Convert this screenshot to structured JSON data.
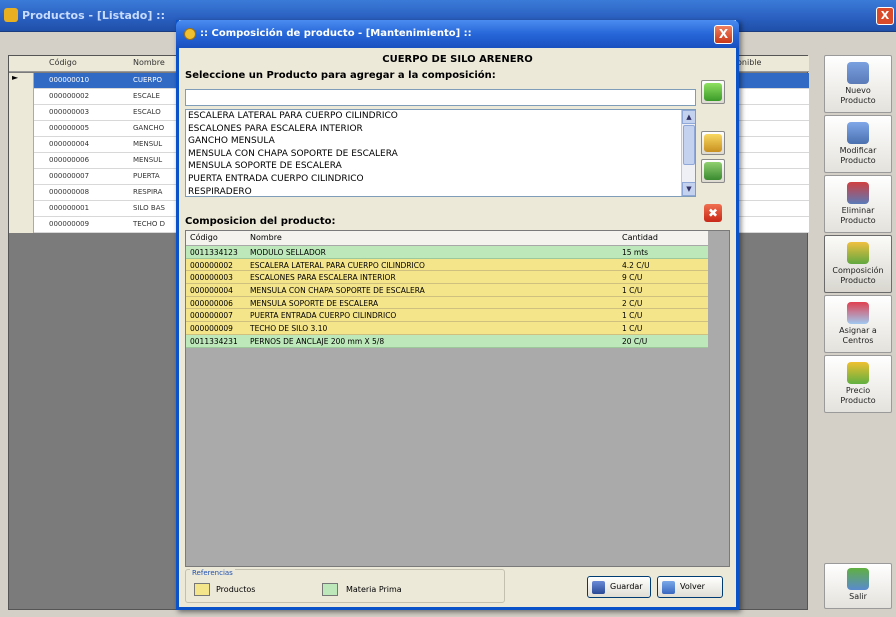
{
  "bg_window": {
    "title": "Productos - [Listado] ::",
    "close": "X"
  },
  "bg_grid": {
    "headers": [
      "Código",
      "Nombre",
      "onible"
    ],
    "rows": [
      {
        "code": "000000010",
        "name": "CUERPO"
      },
      {
        "code": "000000002",
        "name": "ESCALE"
      },
      {
        "code": "000000003",
        "name": "ESCALO"
      },
      {
        "code": "000000005",
        "name": "GANCHO"
      },
      {
        "code": "000000004",
        "name": "MENSUL"
      },
      {
        "code": "000000006",
        "name": "MENSUL"
      },
      {
        "code": "000000007",
        "name": "PUERTA"
      },
      {
        "code": "000000008",
        "name": "RESPIRA"
      },
      {
        "code": "000000001",
        "name": "SILO BAS"
      },
      {
        "code": "000000009",
        "name": "TECHO D"
      }
    ]
  },
  "right_panel": {
    "buttons": [
      {
        "label1": "Nuevo",
        "label2": "Producto"
      },
      {
        "label1": "Modificar",
        "label2": "Producto"
      },
      {
        "label1": "Eliminar",
        "label2": "Producto"
      },
      {
        "label1": "Composición",
        "label2": "Producto"
      },
      {
        "label1": "Asignar a",
        "label2": "Centros"
      },
      {
        "label1": "Precio",
        "label2": "Producto"
      }
    ],
    "exit_label": "Salir"
  },
  "dialog": {
    "title": ":: Composición de producto - [Mantenimiento] ::",
    "close": "X",
    "heading": "CUERPO DE SILO ARENERO",
    "select_label": "Seleccione un Producto para agregar a la composición:",
    "search_value": "",
    "product_list": [
      "ESCALERA LATERAL PARA CUERPO CILINDRICO",
      "ESCALONES PARA ESCALERA INTERIOR",
      "GANCHO MENSULA",
      "MENSULA CON CHAPA SOPORTE DE ESCALERA",
      "MENSULA SOPORTE DE ESCALERA",
      "PUERTA ENTRADA CUERPO CILINDRICO",
      "RESPIRADERO"
    ],
    "composition_label": "Composicion del producto:",
    "comp_headers": {
      "code": "Código",
      "name": "Nombre",
      "qty": "Cantidad"
    },
    "comp_rows": [
      {
        "code": "0011334123",
        "name": "MODULO SELLADOR",
        "qty": "15 mts",
        "kind": "g"
      },
      {
        "code": "000000002",
        "name": "ESCALERA LATERAL PARA CUERPO CILINDRICO",
        "qty": "4.2 C/U",
        "kind": "y"
      },
      {
        "code": "000000003",
        "name": "ESCALONES PARA ESCALERA INTERIOR",
        "qty": "9 C/U",
        "kind": "y"
      },
      {
        "code": "000000004",
        "name": "MENSULA CON CHAPA SOPORTE DE ESCALERA",
        "qty": "1 C/U",
        "kind": "y"
      },
      {
        "code": "000000006",
        "name": "MENSULA SOPORTE DE ESCALERA",
        "qty": "2 C/U",
        "kind": "y"
      },
      {
        "code": "000000007",
        "name": "PUERTA ENTRADA CUERPO CILINDRICO",
        "qty": "1 C/U",
        "kind": "y"
      },
      {
        "code": "000000009",
        "name": "TECHO DE SILO 3.10",
        "qty": "1 C/U",
        "kind": "y"
      },
      {
        "code": "0011334231",
        "name": "PERNOS DE ANCLAJE 200 mm X 5/8",
        "qty": "20 C/U",
        "kind": "g"
      }
    ],
    "refs_title": "Referencias",
    "ref_products": "Productos",
    "ref_raw": "Materia Prima",
    "save_label": "Guardar",
    "back_label": "Volver"
  },
  "colors": {
    "product_row": "#f4e48a",
    "raw_material_row": "#bde8ba",
    "selection": "#316ac5"
  }
}
